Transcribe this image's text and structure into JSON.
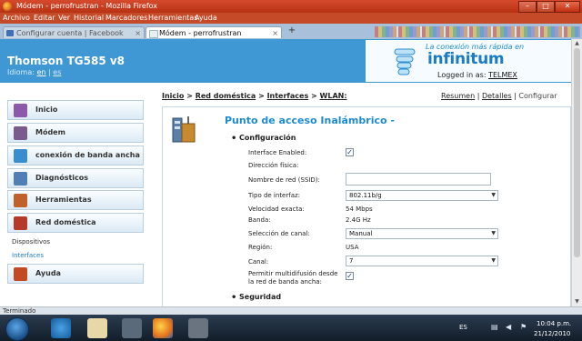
{
  "window": {
    "title": "Módem - perrofrustran - Mozilla Firefox"
  },
  "menu": [
    "Archivo",
    "Editar",
    "Ver",
    "Historial",
    "Marcadores",
    "Herramientas",
    "Ayuda"
  ],
  "tabs": [
    {
      "label": "Configurar cuenta | Facebook"
    },
    {
      "label": "Módem - perrofrustran"
    }
  ],
  "header": {
    "brand": "Thomson TG585 v8",
    "language_label": "Idioma:",
    "languages": [
      "en",
      "es"
    ],
    "ad_tagline": "La conexión más rápida en",
    "ad_brand": "infinitum",
    "logged_in_label": "Logged in as:",
    "logged_in_user": "TELMEX"
  },
  "sidebar": {
    "items": [
      {
        "label": "Inicio",
        "icon": "home-icon"
      },
      {
        "label": "Módem",
        "icon": "modem-icon"
      },
      {
        "label": "conexión de banda ancha",
        "icon": "broadband-icon"
      },
      {
        "label": "Diagnósticos",
        "icon": "diagnostics-icon"
      },
      {
        "label": "Herramientas",
        "icon": "tools-icon"
      },
      {
        "label": "Red doméstica",
        "icon": "home-network-icon"
      }
    ],
    "subitems": [
      "Dispositivos",
      "Interfaces"
    ],
    "help": {
      "label": "Ayuda",
      "icon": "help-icon"
    }
  },
  "breadcrumb": [
    "Inicio",
    "Red doméstica",
    "Interfaces",
    "WLAN:"
  ],
  "view_links": [
    "Resumen",
    "Detalles",
    "Configurar"
  ],
  "page_title": "Punto de acceso Inalámbrico -",
  "config": {
    "section": "Configuración",
    "interface_enabled_label": "Interface Enabled:",
    "interface_enabled": true,
    "mac_label": "Dirección física:",
    "mac_value": "",
    "ssid_label": "Nombre de red (SSID):",
    "ssid_value": "",
    "iface_type_label": "Tipo de interfaz:",
    "iface_type_value": "802.11b/g",
    "speed_label": "Velocidad exacta:",
    "speed_value": "54 Mbps",
    "band_label": "Banda:",
    "band_value": "2.4G Hz",
    "channel_sel_label": "Selección de canal:",
    "channel_sel_value": "Manual",
    "region_label": "Región:",
    "region_value": "USA",
    "channel_label": "Canal:",
    "channel_value": "7",
    "multicast_label_1": "Permitir multidifusión desde",
    "multicast_label_2": "la red de banda ancha:",
    "multicast_enabled": true
  },
  "security": {
    "section": "Seguridad"
  },
  "statusbar": {
    "text": "Terminado"
  },
  "taskbar": {
    "language": "ES",
    "time": "10:04 p.m.",
    "date": "21/12/2010"
  }
}
